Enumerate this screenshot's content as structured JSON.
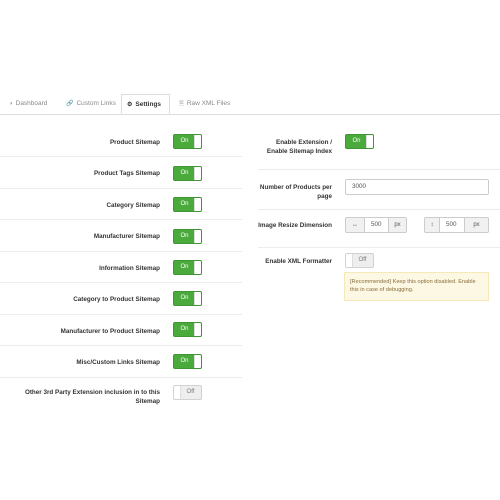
{
  "tabs": [
    {
      "label": "Dashboard",
      "icon": "dashboard-icon",
      "active": false
    },
    {
      "label": "Custom Links",
      "icon": "link-icon",
      "active": false
    },
    {
      "label": "Settings",
      "icon": "gears-icon",
      "active": true
    },
    {
      "label": "Raw XML Files",
      "icon": "file-code-icon",
      "active": false
    }
  ],
  "left_settings": [
    {
      "label": "Product Sitemap",
      "value": "On"
    },
    {
      "label": "Product Tags Sitemap",
      "value": "On"
    },
    {
      "label": "Category Sitemap",
      "value": "On"
    },
    {
      "label": "Manufacturer Sitemap",
      "value": "On"
    },
    {
      "label": "Information Sitemap",
      "value": "On"
    },
    {
      "label": "Category to Product Sitemap",
      "value": "On"
    },
    {
      "label": "Manufacturer to Product Sitemap",
      "value": "On"
    },
    {
      "label": "Misc/Custom Links Sitemap",
      "value": "On"
    },
    {
      "label": "Other 3rd Party Extension inclusion in to this Sitemap",
      "value": "Off"
    }
  ],
  "right_settings": {
    "enable_extension": {
      "label": "Enable Extension / Enable Sitemap Index",
      "value": "On"
    },
    "products_per_page": {
      "label": "Number of Products per page",
      "value": "3000"
    },
    "image_resize": {
      "label": "Image Resize Dimension",
      "width": "500",
      "height": "500",
      "unit": "px",
      "width_icon": "arrows-h-icon",
      "height_icon": "arrows-v-icon"
    },
    "xml_formatter": {
      "label": "Enable XML Formatter",
      "value": "Off",
      "note": "[Recommended] Keep this option disabled. Enable this in case of debugging."
    }
  },
  "colors": {
    "toggle_on": "#4aaa3c",
    "alert_bg": "#fcf8e3",
    "alert_text": "#8a6d3b"
  }
}
